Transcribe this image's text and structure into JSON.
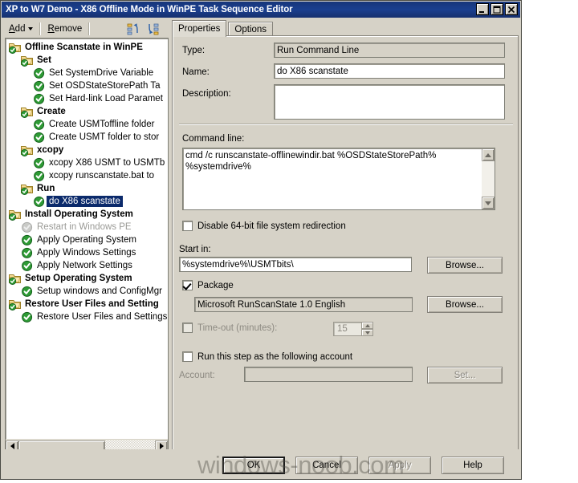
{
  "window": {
    "title": "XP to W7 Demo - X86 Offline Mode in WinPE Task Sequence Editor",
    "minimize_label": "–",
    "maximize_label": "□",
    "close_label": "✕"
  },
  "toolbar": {
    "add_label": "Add",
    "remove_label": "Remove",
    "icon_move_up": "move-step-up-icon",
    "icon_move_down": "move-step-down-icon"
  },
  "tree": {
    "items": [
      {
        "label": "Offline Scanstate in WinPE",
        "indent": 0,
        "type": "folder",
        "bold": true,
        "selected": false,
        "disabled": false
      },
      {
        "label": "Set",
        "indent": 1,
        "type": "folder",
        "bold": true,
        "selected": false,
        "disabled": false
      },
      {
        "label": "Set SystemDrive Variable",
        "indent": 2,
        "type": "step",
        "bold": false,
        "selected": false,
        "disabled": false
      },
      {
        "label": "Set OSDStateStorePath Ta",
        "indent": 2,
        "type": "step",
        "bold": false,
        "selected": false,
        "disabled": false
      },
      {
        "label": "Set Hard-link Load Paramet",
        "indent": 2,
        "type": "step",
        "bold": false,
        "selected": false,
        "disabled": false
      },
      {
        "label": "Create",
        "indent": 1,
        "type": "folder",
        "bold": true,
        "selected": false,
        "disabled": false
      },
      {
        "label": "Create USMToffline folder",
        "indent": 2,
        "type": "step",
        "bold": false,
        "selected": false,
        "disabled": false
      },
      {
        "label": "Create USMT folder to stor",
        "indent": 2,
        "type": "step",
        "bold": false,
        "selected": false,
        "disabled": false
      },
      {
        "label": "xcopy",
        "indent": 1,
        "type": "folder",
        "bold": true,
        "selected": false,
        "disabled": false
      },
      {
        "label": "xcopy X86 USMT to USMTb",
        "indent": 2,
        "type": "step",
        "bold": false,
        "selected": false,
        "disabled": false
      },
      {
        "label": "xcopy runscanstate.bat to",
        "indent": 2,
        "type": "step",
        "bold": false,
        "selected": false,
        "disabled": false
      },
      {
        "label": "Run",
        "indent": 1,
        "type": "folder",
        "bold": true,
        "selected": false,
        "disabled": false
      },
      {
        "label": "do X86 scanstate",
        "indent": 2,
        "type": "step",
        "bold": false,
        "selected": true,
        "disabled": false
      },
      {
        "label": "Install Operating System",
        "indent": 0,
        "type": "folder",
        "bold": true,
        "selected": false,
        "disabled": false
      },
      {
        "label": "Restart in Windows PE",
        "indent": 1,
        "type": "step",
        "bold": false,
        "selected": false,
        "disabled": true
      },
      {
        "label": "Apply Operating System",
        "indent": 1,
        "type": "step",
        "bold": false,
        "selected": false,
        "disabled": false
      },
      {
        "label": "Apply Windows Settings",
        "indent": 1,
        "type": "step",
        "bold": false,
        "selected": false,
        "disabled": false
      },
      {
        "label": "Apply Network Settings",
        "indent": 1,
        "type": "step",
        "bold": false,
        "selected": false,
        "disabled": false
      },
      {
        "label": "Setup Operating System",
        "indent": 0,
        "type": "folder",
        "bold": true,
        "selected": false,
        "disabled": false
      },
      {
        "label": "Setup windows and ConfigMgr",
        "indent": 1,
        "type": "step",
        "bold": false,
        "selected": false,
        "disabled": false
      },
      {
        "label": "Restore User Files and Setting",
        "indent": 0,
        "type": "folder",
        "bold": true,
        "selected": false,
        "disabled": false
      },
      {
        "label": "Restore User Files and Settings",
        "indent": 1,
        "type": "step",
        "bold": false,
        "selected": false,
        "disabled": false
      }
    ],
    "hscroll": {
      "left_arrow": "scroll-left-icon",
      "right_arrow": "scroll-right-icon"
    }
  },
  "tabs": [
    {
      "label": "Properties",
      "active": true
    },
    {
      "label": "Options",
      "active": false
    }
  ],
  "properties": {
    "type_label": "Type:",
    "type_value": "Run Command Line",
    "name_label": "Name:",
    "name_value": "do X86 scanstate",
    "description_label": "Description:",
    "description_value": "",
    "commandline_label": "Command line:",
    "commandline_value": "cmd /c runscanstate-offlinewindir.bat %OSDStateStorePath% %systemdrive%",
    "disable_redirection_label": "Disable 64-bit file system redirection",
    "disable_redirection_checked": false,
    "startin_label": "Start in:",
    "startin_value": "%systemdrive%\\USMTbits\\",
    "startin_browse_label": "Browse...",
    "package_label": "Package",
    "package_checked": true,
    "package_value": "Microsoft RunScanState 1.0 English",
    "package_browse_label": "Browse...",
    "timeout_label": "Time-out (minutes):",
    "timeout_checked": false,
    "timeout_value": "15",
    "runas_label": "Run this step as the following account",
    "runas_checked": false,
    "account_label": "Account:",
    "account_value": "",
    "account_set_label": "Set..."
  },
  "footer": {
    "ok_label": "OK",
    "cancel_label": "Cancel",
    "apply_label": "Apply",
    "apply_disabled": true,
    "help_label": "Help"
  },
  "watermark": {
    "text": "windows-noob.com"
  },
  "colors": {
    "titlebar": "#17357a",
    "face": "#d6d2c7",
    "selection": "#0b2a6b",
    "field": "#ffffff",
    "disabled_text": "#8d8a82"
  }
}
